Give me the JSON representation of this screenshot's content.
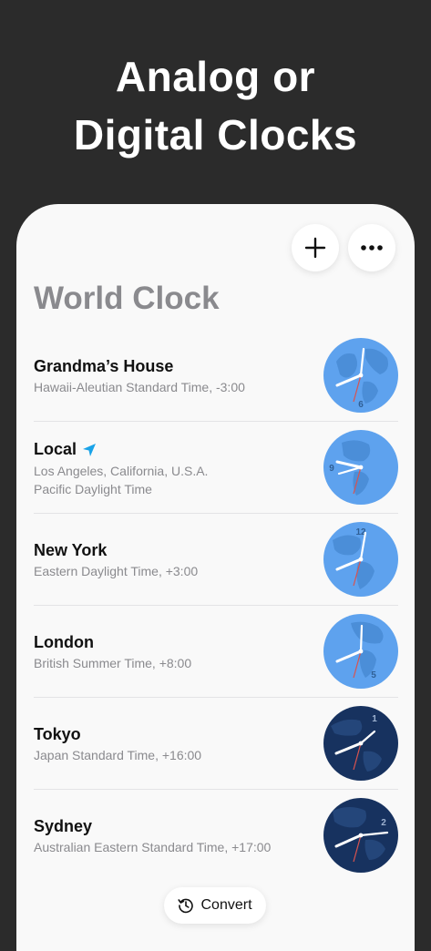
{
  "headline": {
    "line1": "Analog or",
    "line2": "Digital Clocks"
  },
  "toolbar": {
    "add_icon": "plus-icon",
    "more_icon": "ellipsis-icon"
  },
  "screen": {
    "title": "World Clock"
  },
  "clocks": [
    {
      "name": "Grandma’s House",
      "line1": "Hawaii-Aleutian Standard Time, -3:00",
      "number": "6",
      "theme": "day"
    },
    {
      "name": "Local",
      "line1": "Los Angeles, California, U.S.A.",
      "line2": "Pacific Daylight Time",
      "number": "9",
      "theme": "day",
      "icon": "location-arrow-icon"
    },
    {
      "name": "New York",
      "line1": "Eastern Daylight Time, +3:00",
      "number": "12",
      "theme": "day"
    },
    {
      "name": "London",
      "line1": "British Summer Time, +8:00",
      "number": "5",
      "theme": "day"
    },
    {
      "name": "Tokyo",
      "line1": "Japan Standard Time, +16:00",
      "number": "1",
      "theme": "night"
    },
    {
      "name": "Sydney",
      "line1": "Australian Eastern Standard Time, +17:00",
      "number": "2",
      "theme": "night"
    }
  ],
  "convert": {
    "label": "Convert",
    "icon": "history-clock-icon"
  },
  "colors": {
    "background": "#2b2b2b",
    "day_clock": "#5ea2ee",
    "night_clock": "#17325f",
    "second_hand": "#d9534f",
    "location_icon": "#1aa3e8"
  }
}
